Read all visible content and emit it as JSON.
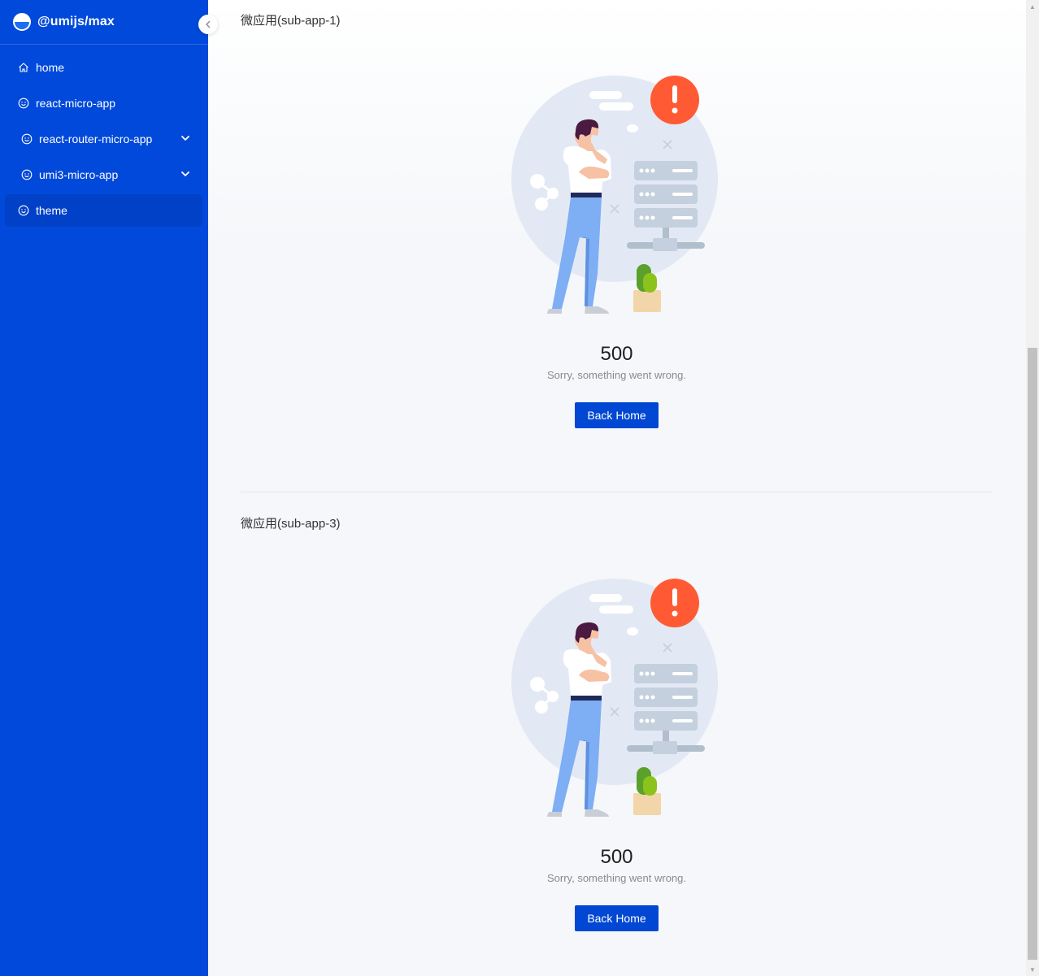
{
  "app": {
    "brand_title": "@umijs/max"
  },
  "sidebar": {
    "items": [
      {
        "label": "home",
        "icon": "home-icon"
      },
      {
        "label": "react-micro-app",
        "icon": "smile-icon"
      },
      {
        "label": "react-router-micro-app",
        "icon": "smile-icon",
        "expandable": true
      },
      {
        "label": "umi3-micro-app",
        "icon": "smile-icon",
        "expandable": true
      },
      {
        "label": "theme",
        "icon": "smile-icon",
        "active": true
      }
    ]
  },
  "sections": [
    {
      "title": "微应用(sub-app-1)",
      "status": "500",
      "subtitle": "Sorry, something went wrong.",
      "button": "Back Home"
    },
    {
      "title": "微应用(sub-app-3)",
      "status": "500",
      "subtitle": "Sorry, something went wrong.",
      "button": "Back Home"
    }
  ],
  "colors": {
    "sidebar_bg": "#0049db",
    "active_item_bg": "#0041c8",
    "primary_button": "#0047d3",
    "error_badge": "#ff5a34"
  }
}
